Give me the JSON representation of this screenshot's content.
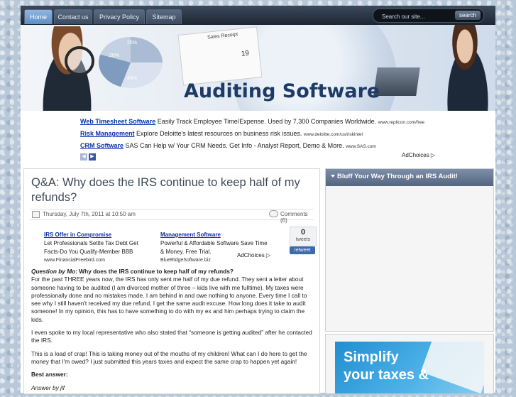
{
  "nav": {
    "items": [
      "Home",
      "Contact us",
      "Privacy Policy",
      "Sitemap"
    ],
    "search_placeholder": "Search our site...",
    "search_button": "search"
  },
  "header": {
    "site_title": "Auditing Software",
    "sheet_title": "Sales Receipt",
    "sheet_number": "19",
    "pie_labels": [
      "25%",
      "20%",
      "45%"
    ]
  },
  "ads_top": [
    {
      "title": "Web Timesheet Software",
      "text": "Easily Track Employee Time/Expense. Used by 7,300 Companies Worldwide.",
      "url": "www.replicon.com/free"
    },
    {
      "title": "Risk Management",
      "text": "Explore Deloitte's latest resources on business risk issues.",
      "url": "www.deloitte.com/us/riskintel"
    },
    {
      "title": "CRM Software",
      "text": "SAS Can Help w/ Your CRM Needs. Get Info - Analyst Report, Demo & More.",
      "url": "www.SAS.com"
    }
  ],
  "adchoices": "AdChoices",
  "post": {
    "title": "Q&A: Why does the IRS continue to keep half of my refunds?",
    "date": "Thursday, July 7th, 2011 at 10:50 am",
    "comments": "Comments (6)",
    "inline_ads": [
      {
        "title": "IRS Offer in Compromise",
        "text": "Let Professionals Settle Tax Debt Get Facts-Do You Qualify-Member BBB",
        "url": "www.FinancialFreebird.com"
      },
      {
        "title": "Management Software",
        "text": "Powerful & Affordable Software Save Time & Money. Free Trial.",
        "url": "BlueRidgeSoftware.biz"
      }
    ],
    "tweet_count": "0",
    "tweet_label": "tweets",
    "retweet": "retweet",
    "question_prefix": "Question by Mo",
    "question_text": ": Why does the IRS continue to keep half of my refunds?",
    "paragraphs": [
      "For the past THREE years now, the IRS has only sent me half of my due refund. They sent a letter about someone having to be audited (I am divorced mother of three – kids live with me fulltime). My taxes were professionally done and no mistakes made. I am behind in and owe nothing to anyone. Every time I call to see why I still haven't received my due refund, I get the same audit excuse. How long does it take to audit someone! In my opinion, this has to have something to do with my ex and him perhaps trying to claim the kids.",
      "I even spoke to my local representative who also stated that “someone is getting audited” after he contacted the IRS.",
      "This is a load of crap! This is taking money out of the mouths of my children! What can I do here to get the money that I'm owed? I just submitted this years taxes and expect the same crap to happen yet again!"
    ],
    "best_answer": "Best answer:",
    "answer_by": "Answer by jlf"
  },
  "sidebar": {
    "title": "Bluff Your Way Through an IRS Audit!",
    "promo_line1": "Simplify",
    "promo_line2": "your taxes &"
  }
}
